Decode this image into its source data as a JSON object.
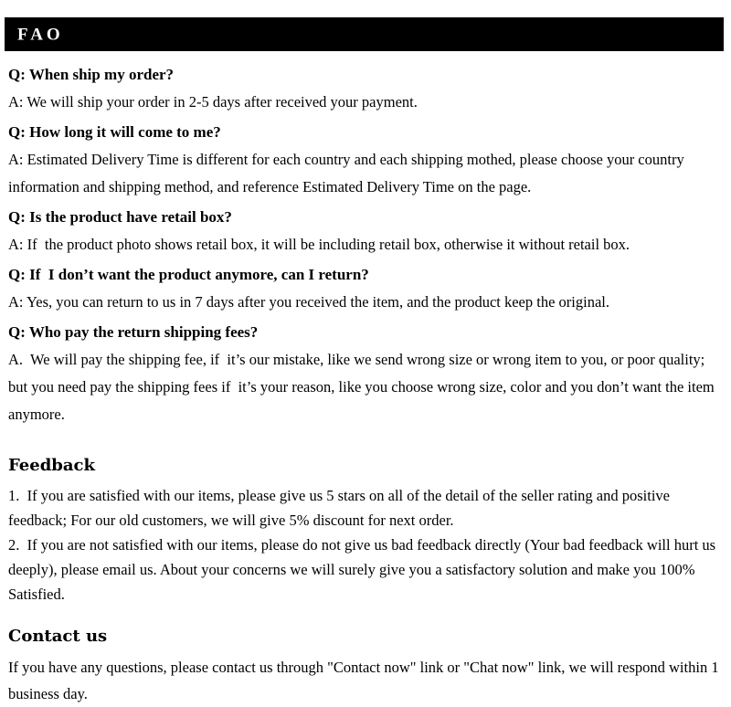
{
  "header": {
    "title": "FAO",
    "background_color": "#000000",
    "text_color": "#ffffff"
  },
  "faq": {
    "items": [
      {
        "question": "Q: When ship my order?",
        "answer": "A: We will ship your order in 2-5 days after received your payment."
      },
      {
        "question": "Q: How long it will come to me?",
        "answer": "A: Estimated Delivery Time is different for each country and each shipping mothed, please choose your country information and shipping method, and reference Estimated Delivery Time on the page."
      },
      {
        "question": "Q: Is the product have retail box?",
        "answer": "A: If  the product photo shows retail box, it will be including retail box, otherwise it without retail box."
      },
      {
        "question": "Q: If  I don’t want the product anymore, can I return?",
        "answer": "A: Yes, you can return to us in 7 days after you received the item, and the product keep the original."
      },
      {
        "question": "Q: Who pay the return shipping fees?",
        "answer": "A.  We will pay the shipping fee, if  it’s our mistake, like we send wrong size or wrong item to you, or poor quality; but you need pay the shipping fees if  it’s your reason, like you choose wrong size, color and you don’t want the item anymore."
      }
    ]
  },
  "feedback": {
    "heading": "Feedback",
    "point_1": "1.  If you are satisfied with our items, please give us 5 stars on all of the detail of the seller rating and positive feedback; For our old customers, we will give 5% discount for next order.",
    "point_2": "2.  If you are not satisfied with our items, please do not give us bad feedback directly (Your bad feedback will hurt us deeply), please email us. About your concerns we will surely give you a satisfactory solution and make you 100% Satisfied."
  },
  "contact": {
    "heading": "Contact us",
    "body": "If you have any questions, please contact us through \"Contact now\" link or \"Chat now\" link, we will respond within 1 business day."
  }
}
